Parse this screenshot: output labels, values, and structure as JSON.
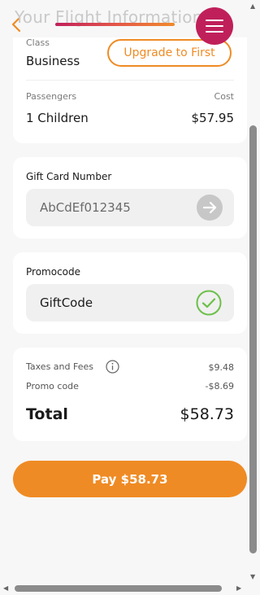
{
  "header": {
    "title": "Your Flight Information"
  },
  "class_section": {
    "label": "Class",
    "value": "Business",
    "upgrade_label": "Upgrade to First"
  },
  "passengers": {
    "label": "Passengers",
    "value": "1 Children",
    "cost_label": "Cost",
    "cost_value": "$57.95"
  },
  "gift_card": {
    "label": "Gift Card Number",
    "value": "AbCdEf012345"
  },
  "promo": {
    "label": "Promocode",
    "value": "GiftCode"
  },
  "summary": {
    "taxes_label": "Taxes and Fees",
    "taxes_value": "$9.48",
    "promo_label": "Promo code",
    "promo_value": "-$8.69",
    "total_label": "Total",
    "total_value": "$58.73"
  },
  "pay_button": {
    "label": "Pay $58.73"
  },
  "colors": {
    "accent": "#ef8b24",
    "brand": "#c0205a"
  }
}
